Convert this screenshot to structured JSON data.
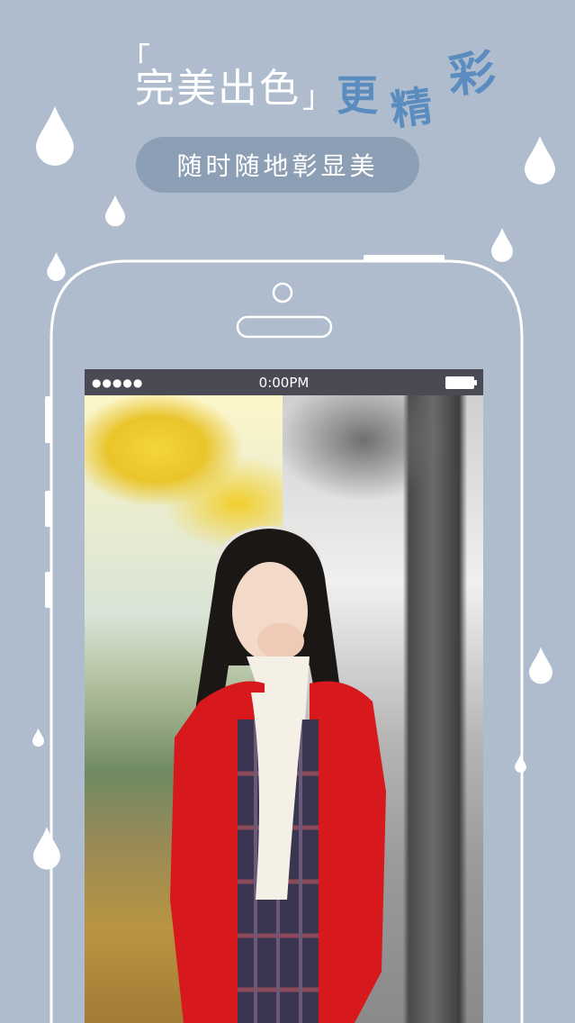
{
  "headline": {
    "bracket_open": "「",
    "main": "完美出色",
    "bracket_close": "」",
    "accent_1": "更",
    "accent_2": "精",
    "accent_3": "彩"
  },
  "subtitle": "随时随地彰显美",
  "phone": {
    "status_bar": {
      "signal": "●●●●●",
      "time": "0:00PM",
      "battery_icon": "battery-icon"
    }
  },
  "colors": {
    "background": "#aebcce",
    "accent_text": "#5b8cbf",
    "pill": "#8c9fb5",
    "status_bar": "#4a4a55"
  }
}
